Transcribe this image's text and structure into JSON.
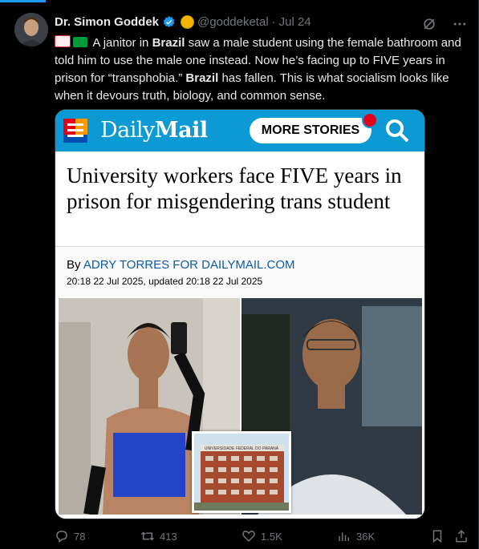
{
  "author": {
    "name": "Dr. Simon Goddek",
    "handle": "@goddeketal",
    "separator": "·",
    "date": "Jul 24"
  },
  "tweet": {
    "flag1": "🇨🇳",
    "flag2": "🇧🇷",
    "t1": "A janitor in ",
    "b1": "Brazil",
    "t2": " saw a male student using the female bathroom and told him to use the male one instead. Now he’s facing up to FIVE years in prison for “transphobia.” ",
    "b2": "Brazil",
    "t3": " has fallen. This is what socialism looks like when it devours truth, biology, and common sense."
  },
  "card": {
    "brand_light": "Daily",
    "brand_bold": "Mail",
    "more_stories": "MORE STORIES",
    "headline": "University workers face FIVE years in prison for misgendering trans student",
    "by_prefix": "By ",
    "by_author": "ADRY TORRES FOR DAILYMAIL.COM",
    "dateline": "20:18 22 Jul 2025, updated 20:18 22 Jul 2025",
    "inset_sign": "UNIVERSIDADE FEDERAL DO PARANÁ"
  },
  "actions": {
    "replies": "78",
    "reposts": "413",
    "likes": "1.5K",
    "views": "36K"
  },
  "colors": {
    "accent": "#1d9bf0",
    "dailymail_blue": "#0c9ad4",
    "muted": "#71767b"
  }
}
